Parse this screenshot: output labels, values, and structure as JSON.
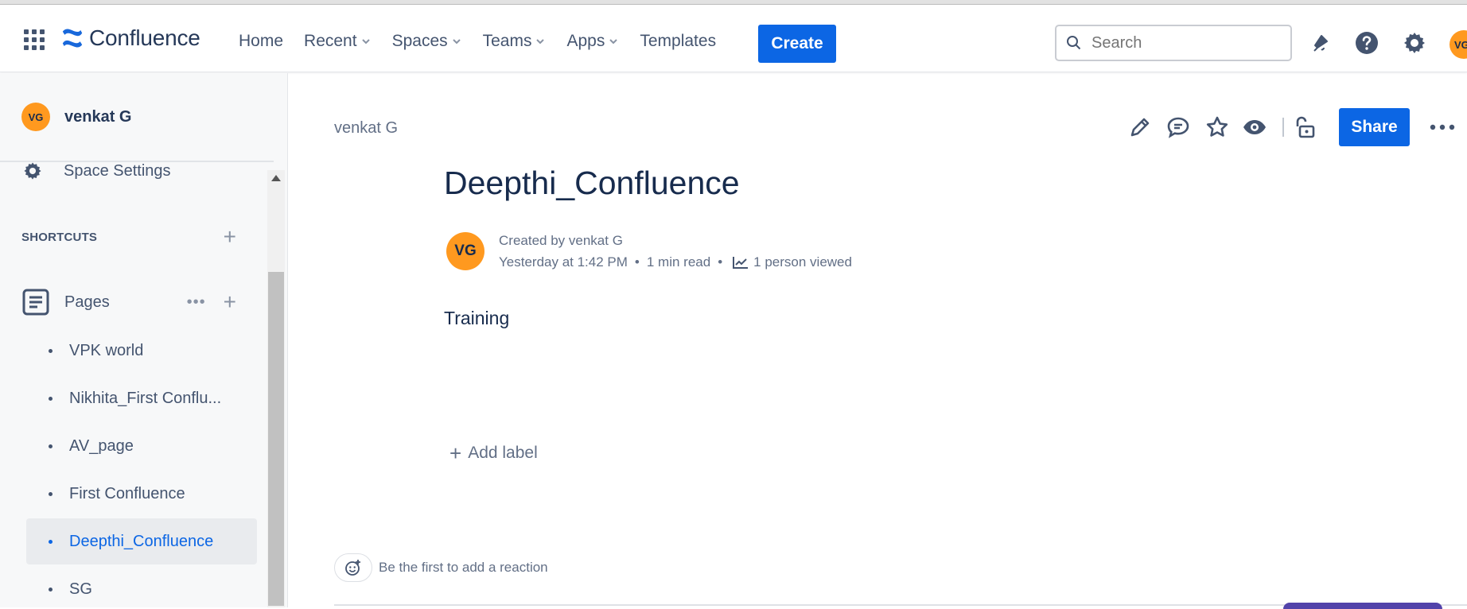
{
  "header": {
    "product": "Confluence",
    "nav": [
      "Home",
      "Recent",
      "Spaces",
      "Teams",
      "Apps",
      "Templates"
    ],
    "create_label": "Create",
    "search_placeholder": "Search",
    "user_initials": "VG"
  },
  "sidebar": {
    "space_initials": "VG",
    "space_name": "venkat G",
    "settings_label": "Space Settings",
    "shortcuts_label": "SHORTCUTS",
    "pages_label": "Pages",
    "pages": [
      "VPK world",
      "Nikhita_First Conflu...",
      "AV_page",
      "First Confluence",
      "Deepthi_Confluence",
      "SG"
    ],
    "active_page": "Deepthi_Confluence"
  },
  "main": {
    "breadcrumb": "venkat G",
    "share_label": "Share",
    "title": "Deepthi_Confluence",
    "author_initials": "VG",
    "created_by": "Created by venkat G",
    "created_time": "Yesterday at 1:42 PM",
    "read_time": "1 min read",
    "views": "1 person viewed",
    "body": "Training",
    "add_label": "Add label",
    "reaction_prompt": "Be the first to add a reaction"
  },
  "colors": {
    "brand_blue": "#0c66e4",
    "avatar_orange": "#ff991f",
    "text_primary": "#172b4d",
    "text_subtle": "#626f86"
  }
}
